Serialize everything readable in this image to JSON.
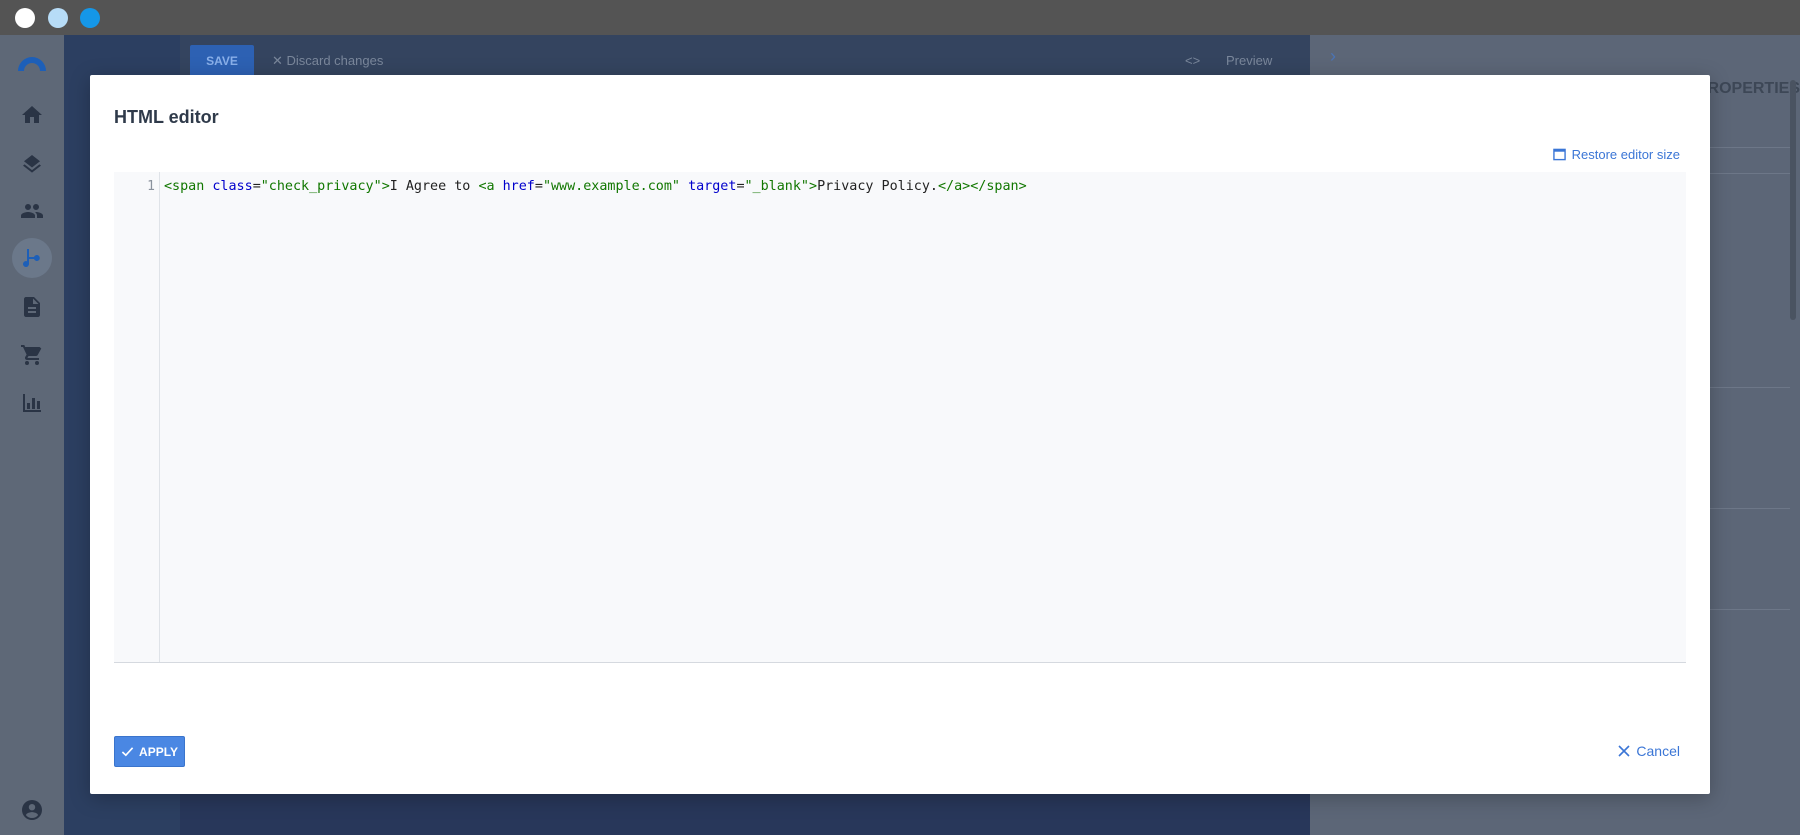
{
  "background": {
    "save_label": "SAVE",
    "discard_label": "✕ Discard changes",
    "preview_label": "Preview",
    "code_symbol": "<>",
    "properties_title": "PROPERTIES"
  },
  "modal": {
    "title": "HTML editor",
    "restore_label": "Restore editor size",
    "line_number": "1",
    "code": {
      "t1": "<span ",
      "a1": "class",
      "e1": "=",
      "s1": "\"check_privacy\"",
      "t2": ">",
      "x1": "I Agree to ",
      "t3": "<a ",
      "a2": "href",
      "e2": "=",
      "s2": "\"www.example.com\"",
      "sp": " ",
      "a3": "target",
      "e3": "=",
      "s3": "\"_blank\"",
      "t4": ">",
      "x2": "Privacy Policy.",
      "t5": "</a></span>"
    },
    "apply_label": "APPLY",
    "cancel_label": "Cancel"
  },
  "colors": {
    "accent": "#4a87e3",
    "link": "#3b76d6"
  }
}
